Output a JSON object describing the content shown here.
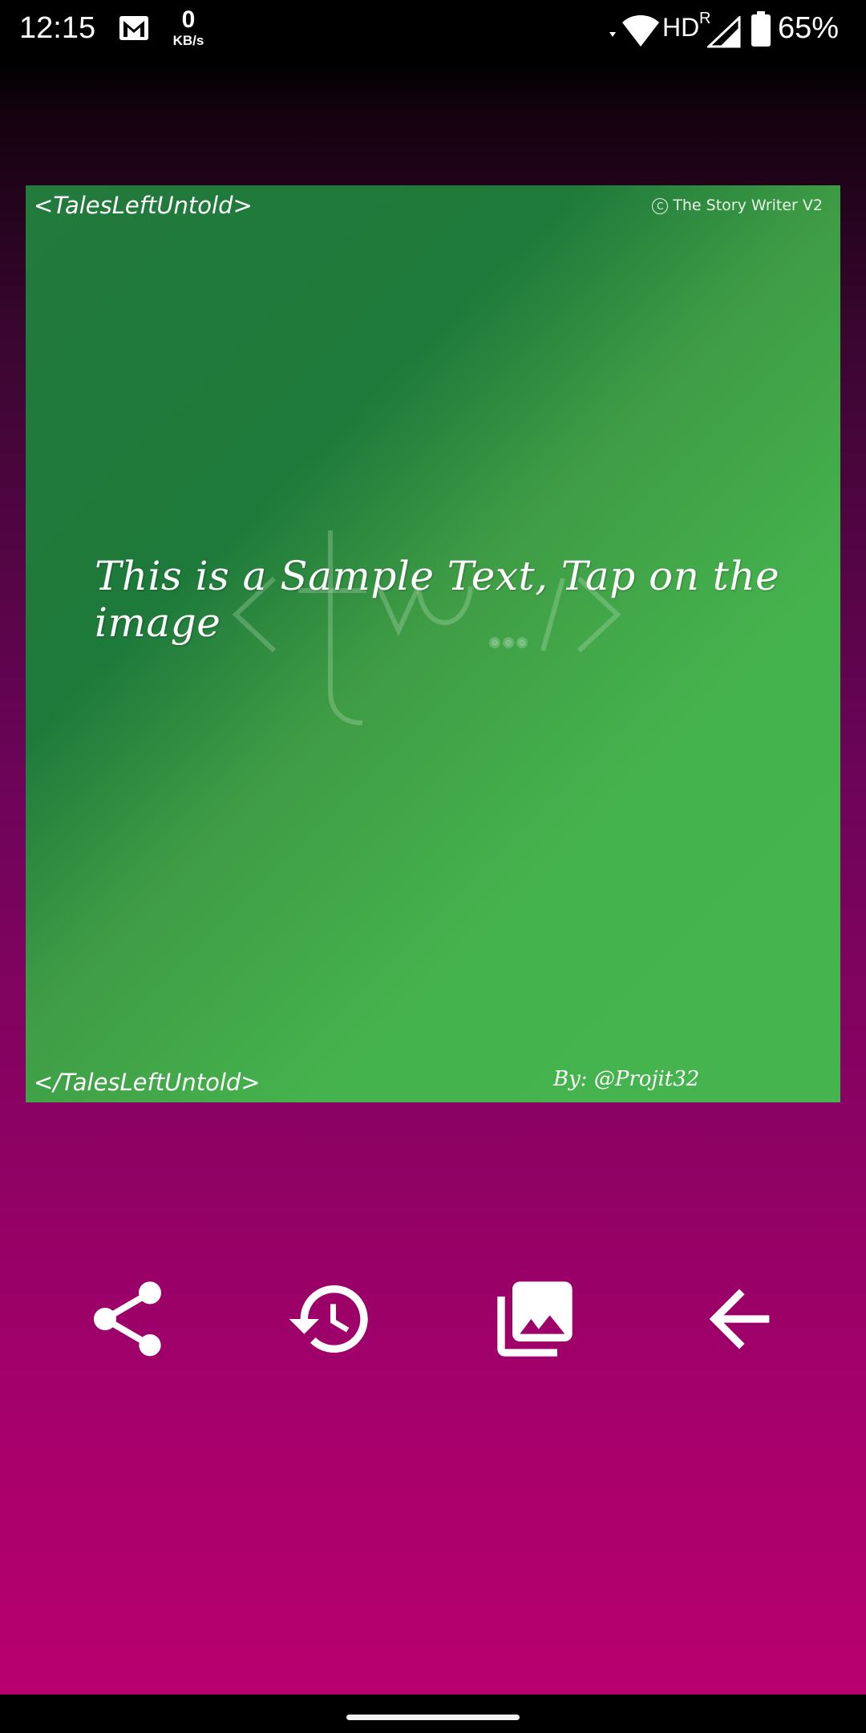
{
  "status_bar": {
    "time": "12:15",
    "speed_value": "0",
    "speed_unit": "KB/s",
    "network_type": "HD",
    "roaming": "R",
    "battery_percent": "65%",
    "icons": [
      "gmail-icon",
      "wifi-icon",
      "signal-icon",
      "battery-icon"
    ]
  },
  "card": {
    "tag_top": "<TalesLeftUntold>",
    "copyright": "The Story Writer V2",
    "sample_text": "This is a Sample Text, Tap on the image",
    "tag_bottom": "</TalesLeftUntold>",
    "author": "By: @Projit32",
    "gradient_colors": [
      "#227a3c",
      "#1e7a3a",
      "#45b34e"
    ]
  },
  "actions": [
    {
      "name": "share",
      "icon": "share-icon"
    },
    {
      "name": "history",
      "icon": "history-icon"
    },
    {
      "name": "gallery",
      "icon": "gallery-icon"
    },
    {
      "name": "back",
      "icon": "arrow-left-icon"
    }
  ],
  "colors": {
    "background_top": "#000000",
    "background_bottom": "#b8006f",
    "icon": "#ffffff"
  }
}
